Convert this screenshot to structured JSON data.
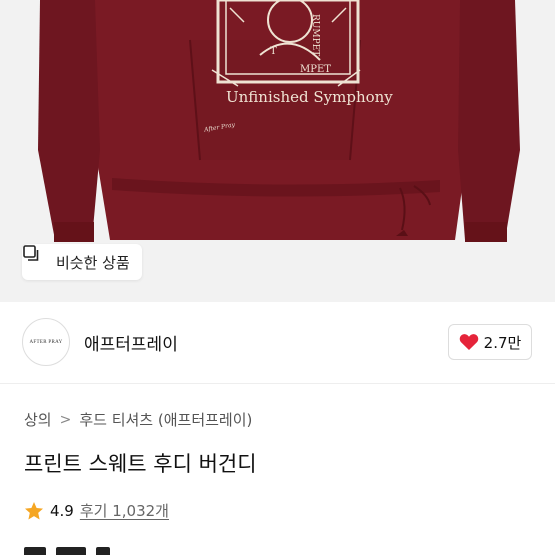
{
  "hero": {
    "print_text_1": "RUMPET",
    "print_text_2": "T",
    "print_text_3": "MPET",
    "print_text_4": "Unfinished Symphony",
    "signature": "After Pray",
    "similar_button_label": "비슷한 상품",
    "hoodie_color": "#7a1a24"
  },
  "brand": {
    "logo_text": "AFTER PRAY",
    "name": "애프터프레이",
    "like_count": "2.7만",
    "like_color": "#e5243a"
  },
  "breadcrumb": {
    "category": "상의",
    "separator": ">",
    "subcategory": "후드 티셔츠 (애프터프레이)"
  },
  "product": {
    "title": "프린트 스웨트 후디 버건디",
    "rating": "4.9",
    "reviews_label": "후기 1,032개",
    "star_color": "#f5a623"
  }
}
